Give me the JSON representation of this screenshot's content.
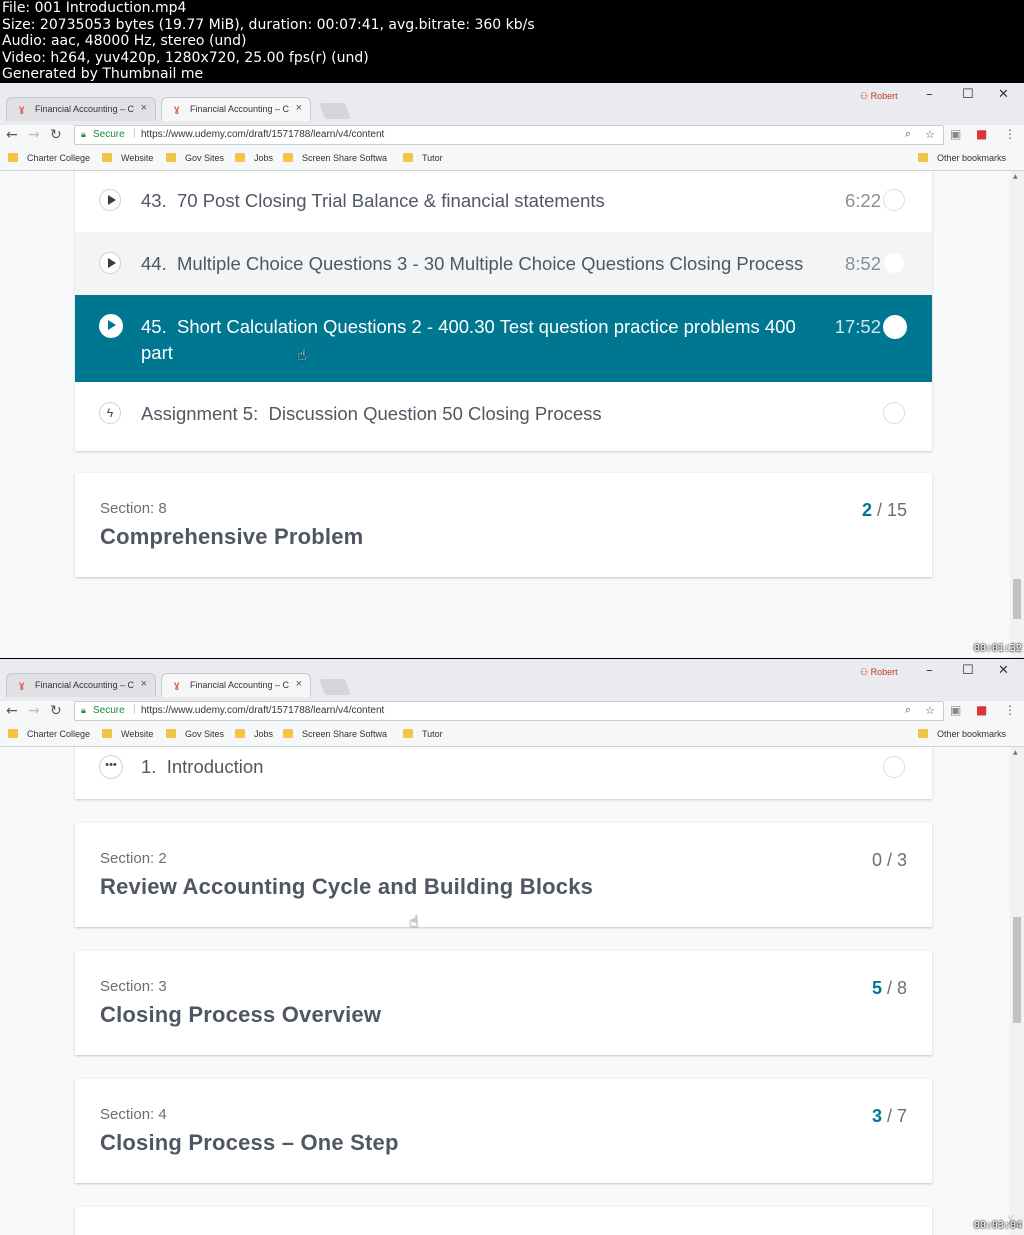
{
  "meta_lines": [
    "File: 001 Introduction.mp4",
    "Size: 20735053 bytes (19.77 MiB), duration: 00:07:41, avg.bitrate: 360 kb/s",
    "Audio: aac, 48000 Hz, stereo (und)",
    "Video: h264, yuv420p, 1280x720, 25.00 fps(r) (und)",
    "Generated by Thumbnail me"
  ],
  "browser": {
    "tabs": [
      "Financial Accounting – C",
      "Financial Accounting – C"
    ],
    "user": "Robert",
    "secure_label": "Secure",
    "url": "https://www.udemy.com/draft/1571788/learn/v4/content",
    "bookmarks": [
      "Charter College",
      "Website",
      "Gov Sites",
      "Jobs",
      "Screen Share Softwa",
      "Tutor"
    ],
    "other_bookmarks": "Other bookmarks"
  },
  "frame1": {
    "lectures": [
      {
        "num": "43.",
        "title": "70 Post Closing Trial Balance & financial statements",
        "duration": "6:22"
      },
      {
        "num": "44.",
        "title": "Multiple Choice Questions 3 - 30 Multiple Choice Questions Closing Process",
        "duration": "8:52"
      },
      {
        "num": "45.",
        "title": "Short Calculation Questions 2 - 400.30 Test question practice problems 400",
        "title2": "part",
        "duration": "17:52"
      }
    ],
    "assignment": {
      "label": "Assignment 5:",
      "title": "Discussion Question 50 Closing Process"
    },
    "section": {
      "label": "Section: 8",
      "title": "Comprehensive Problem",
      "done": "2",
      "total": "/ 15"
    },
    "timestamp": "00:01:32"
  },
  "frame2": {
    "lecture": {
      "num": "1.",
      "title": "Introduction"
    },
    "sections": [
      {
        "label": "Section: 2",
        "title": "Review Accounting Cycle and Building Blocks",
        "done": "0",
        "total": "/ 3"
      },
      {
        "label": "Section: 3",
        "title": "Closing Process Overview",
        "done": "5",
        "total": "/ 8"
      },
      {
        "label": "Section: 4",
        "title": "Closing Process – One Step",
        "done": "3",
        "total": "/ 7"
      }
    ],
    "timestamp": "00:03:04"
  },
  "icons": {
    "back": "arrow-left-icon",
    "forward": "arrow-right-icon",
    "reload": "reload-icon",
    "play": "play-icon",
    "bolt": "bolt-icon",
    "more": "more-dots-icon"
  },
  "colors": {
    "accent": "#007791",
    "text": "#505763"
  }
}
